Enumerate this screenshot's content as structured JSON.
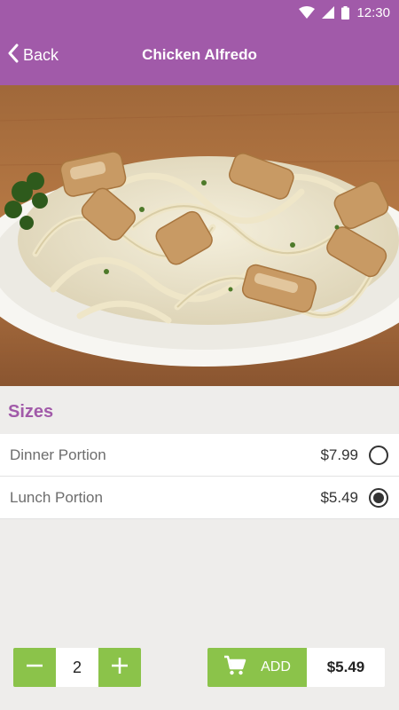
{
  "status_bar": {
    "time": "12:30",
    "icons": [
      "wifi-icon",
      "signal-icon",
      "battery-icon"
    ]
  },
  "app_bar": {
    "back_label": "Back",
    "title": "Chicken Alfredo",
    "color": "#a15aa9"
  },
  "hero": {
    "image": "chicken-alfredo-photo"
  },
  "sizes": {
    "title": "Sizes",
    "items": [
      {
        "name": "Dinner Portion",
        "price": "$7.99",
        "selected": false
      },
      {
        "name": "Lunch Portion",
        "price": "$5.49",
        "selected": true
      }
    ]
  },
  "cart": {
    "quantity": "2",
    "decrement_icon": "minus-icon",
    "increment_icon": "plus-icon",
    "add_label": "ADD",
    "cart_icon": "cart-icon",
    "total": "$5.49",
    "accent": "#8bc34a"
  }
}
